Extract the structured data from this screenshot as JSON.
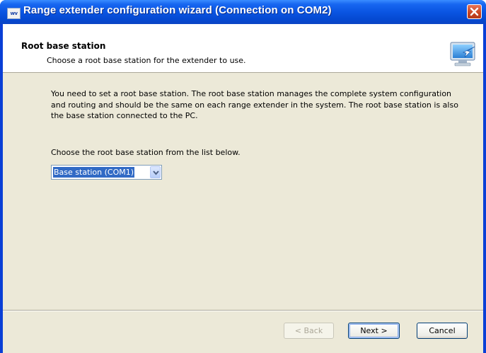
{
  "window": {
    "title": "Range extender configuration wizard (Connection on COM2)",
    "app_icon_text": "wv",
    "close_icon": "close-icon"
  },
  "header": {
    "title": "Root base station",
    "subtitle": "Choose a root base station for the extender to use.",
    "icon": "wizard-connect-icon"
  },
  "content": {
    "description": "You need to set a root base station. The root base station manages the complete system configuration and routing and should be the same on each range extender in the system. The root base station is also the base station connected to the PC.",
    "choose_label": "Choose the root base station from the list below.",
    "root_base_select": {
      "selected": "Base station (COM1)"
    }
  },
  "buttons": {
    "back": "< Back",
    "next": "Next >",
    "cancel": "Cancel"
  },
  "colors": {
    "titlebar": "#0a55e2",
    "dialog_bg": "#ece9d8",
    "selection": "#316ac5",
    "close_button": "#c9431f"
  }
}
